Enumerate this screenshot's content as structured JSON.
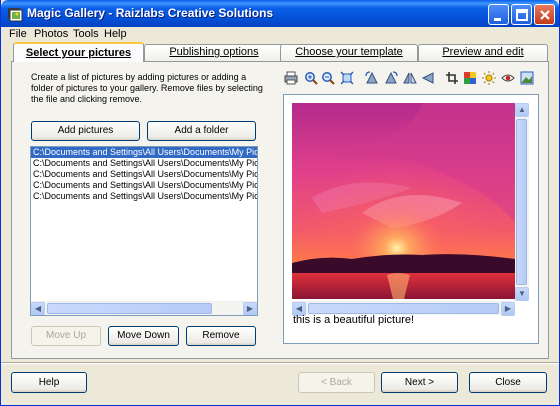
{
  "window": {
    "title": "Magic Gallery - Raizlabs Creative Solutions",
    "minimize_label": "_",
    "maximize_label": "□",
    "close_label": "✕"
  },
  "menu": [
    "File",
    "Photos",
    "Tools",
    "Help"
  ],
  "tabs": [
    {
      "label": "Select your pictures",
      "active": true
    },
    {
      "label": "Publishing options",
      "active": false
    },
    {
      "label": "Choose your template",
      "active": false
    },
    {
      "label": "Preview and edit",
      "active": false
    }
  ],
  "left_panel": {
    "description": "Create a list of pictures by adding pictures or adding a folder of pictures to your gallery.  Remove files by selecting the file and clicking remove.",
    "add_pictures_label": "Add pictures",
    "add_folder_label": "Add a folder",
    "files": [
      "C:\\Documents and Settings\\All Users\\Documents\\My Pict",
      "C:\\Documents and Settings\\All Users\\Documents\\My Pict",
      "C:\\Documents and Settings\\All Users\\Documents\\My Pict",
      "C:\\Documents and Settings\\All Users\\Documents\\My Pict",
      "C:\\Documents and Settings\\All Users\\Documents\\My Pict"
    ],
    "selected_index": 0,
    "move_up_label": "Move Up",
    "move_down_label": "Move Down",
    "remove_label": "Remove"
  },
  "toolbar": {
    "icons": [
      "print-icon",
      "zoom-in-icon",
      "zoom-out-icon",
      "fit-icon",
      "rotate-left-icon",
      "rotate-right-icon",
      "flip-vertical-icon",
      "flip-horizontal-icon",
      "crop-icon",
      "color-icon",
      "brightness-icon",
      "red-eye-icon",
      "image-properties-icon"
    ]
  },
  "preview": {
    "caption": "this is a beautiful picture!"
  },
  "footer": {
    "help_label": "Help",
    "back_label": "< Back",
    "next_label": "Next >",
    "close_label": "Close"
  }
}
